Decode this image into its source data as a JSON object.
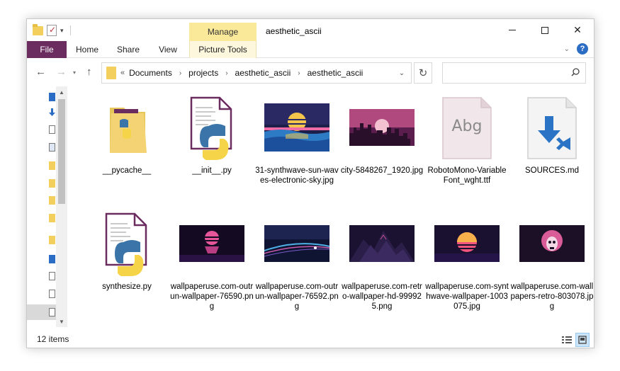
{
  "window": {
    "title": "aesthetic_ascii",
    "contextual_tab": "Manage"
  },
  "ribbon": {
    "tabs": [
      "File",
      "Home",
      "Share",
      "View",
      "Picture Tools"
    ]
  },
  "address": {
    "overflow": "«",
    "crumbs": [
      "Documents",
      "projects",
      "aesthetic_ascii",
      "aesthetic_ascii"
    ]
  },
  "search": {
    "placeholder": ""
  },
  "items": [
    {
      "name": "__pycache__",
      "type": "folder"
    },
    {
      "name": "__init__.py",
      "type": "python"
    },
    {
      "name": "31-synthwave-sun-waves-electronic-sky.jpg",
      "type": "image",
      "theme": "sun-waves"
    },
    {
      "name": "city-5848267_1920.jpg",
      "type": "image",
      "theme": "city"
    },
    {
      "name": "RobotoMono-VariableFont_wght.ttf",
      "type": "font",
      "preview": "Abg"
    },
    {
      "name": "SOURCES.md",
      "type": "markdown"
    },
    {
      "name": "synthesize.py",
      "type": "python"
    },
    {
      "name": "wallpaperuse.com-outrun-wallpaper-76590.png",
      "type": "image",
      "theme": "outrun-1"
    },
    {
      "name": "wallpaperuse.com-outrun-wallpaper-76592.png",
      "type": "image",
      "theme": "outrun-2"
    },
    {
      "name": "wallpaperuse.com-retro-wallpaper-hd-999925.png",
      "type": "image",
      "theme": "retro-hd"
    },
    {
      "name": "wallpaperuse.com-synthwave-wallpaper-1003075.jpg",
      "type": "image",
      "theme": "synthwave"
    },
    {
      "name": "wallpaperuse.com-wallpapers-retro-803078.jpg",
      "type": "image",
      "theme": "retro-skull"
    }
  ],
  "status": {
    "count": "12 items"
  },
  "colors": {
    "file_tab": "#6b2c60",
    "manage_tab": "#fbe99a",
    "folder": "#f3cf5e",
    "python_blue": "#3b74a8",
    "python_yellow": "#f6d44a",
    "accent": "#2b6cc4"
  }
}
